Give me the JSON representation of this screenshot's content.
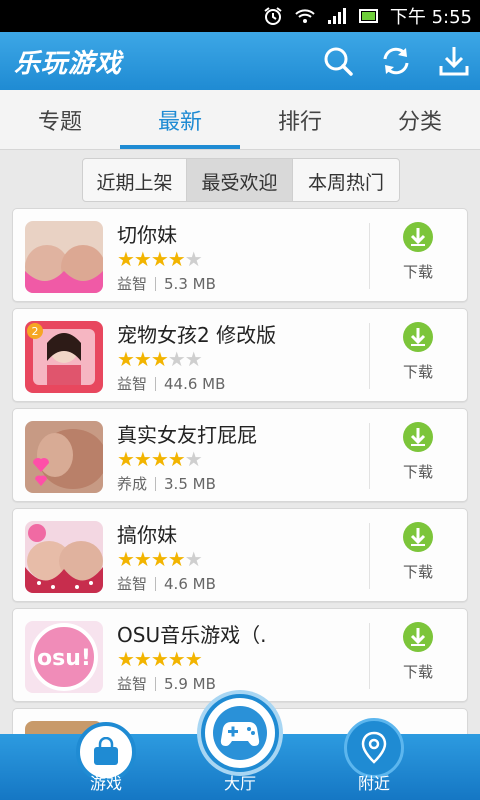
{
  "status_bar": {
    "time": "下午 5:55"
  },
  "app": {
    "title": "乐玩游戏"
  },
  "tabs": [
    {
      "label": "专题",
      "active": false
    },
    {
      "label": "最新",
      "active": true
    },
    {
      "label": "排行",
      "active": false
    },
    {
      "label": "分类",
      "active": false
    }
  ],
  "segments": [
    {
      "label": "近期上架",
      "active": false
    },
    {
      "label": "最受欢迎",
      "active": true
    },
    {
      "label": "本周热门",
      "active": false
    }
  ],
  "games": [
    {
      "name": "切你妹",
      "rating": 4,
      "category": "益智",
      "size": "5.3 MB",
      "download_label": "下载"
    },
    {
      "name": "宠物女孩2 修改版",
      "rating": 3,
      "category": "益智",
      "size": "44.6 MB",
      "download_label": "下载"
    },
    {
      "name": "真实女友打屁屁",
      "rating": 4,
      "category": "养成",
      "size": "3.5 MB",
      "download_label": "下载"
    },
    {
      "name": "搞你妹",
      "rating": 4,
      "category": "益智",
      "size": "4.6 MB",
      "download_label": "下载"
    },
    {
      "name": "OSU音乐游戏（.",
      "rating": 5,
      "category": "益智",
      "size": "5.9 MB",
      "download_label": "下载"
    }
  ],
  "bottom_nav": [
    {
      "label": "游戏",
      "icon": "shopping-bag-icon"
    },
    {
      "label": "大厅",
      "icon": "gamepad-icon"
    },
    {
      "label": "附近",
      "icon": "location-pin-icon"
    }
  ],
  "colors": {
    "primary": "#1f8bd3",
    "download_green": "#7cc53a",
    "star": "#f2b400"
  }
}
